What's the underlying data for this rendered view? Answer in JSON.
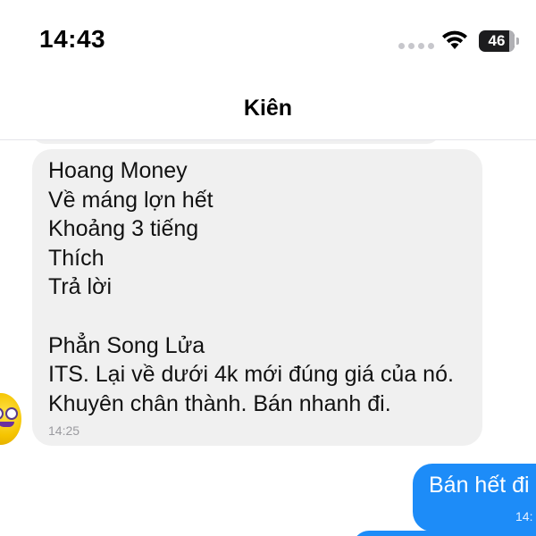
{
  "status_bar": {
    "time": "14:43",
    "battery": "46",
    "icons": [
      "cellular-signal-icon",
      "wifi-icon",
      "battery-icon"
    ]
  },
  "header": {
    "contact_name": "Kiên"
  },
  "messages": {
    "incoming": {
      "lines": [
        "Hoang Money",
        "Về máng lợn hết",
        "Khoảng 3 tiếng",
        "Thích",
        "Trả lời",
        "",
        "Phẳn Song Lửa",
        "ITS. Lại về dưới 4k mới đúng giá của nó.",
        "Khuyên chân thành. Bán nhanh đi."
      ],
      "time": "14:25"
    },
    "outgoing": {
      "text": "Bán hết đi",
      "time": "14:"
    }
  },
  "colors": {
    "incoming_bubble": "#f0f0f0",
    "outgoing_bubble": "#1d8cf8",
    "text": "#111111",
    "timestamp": "#9a9a9f"
  }
}
